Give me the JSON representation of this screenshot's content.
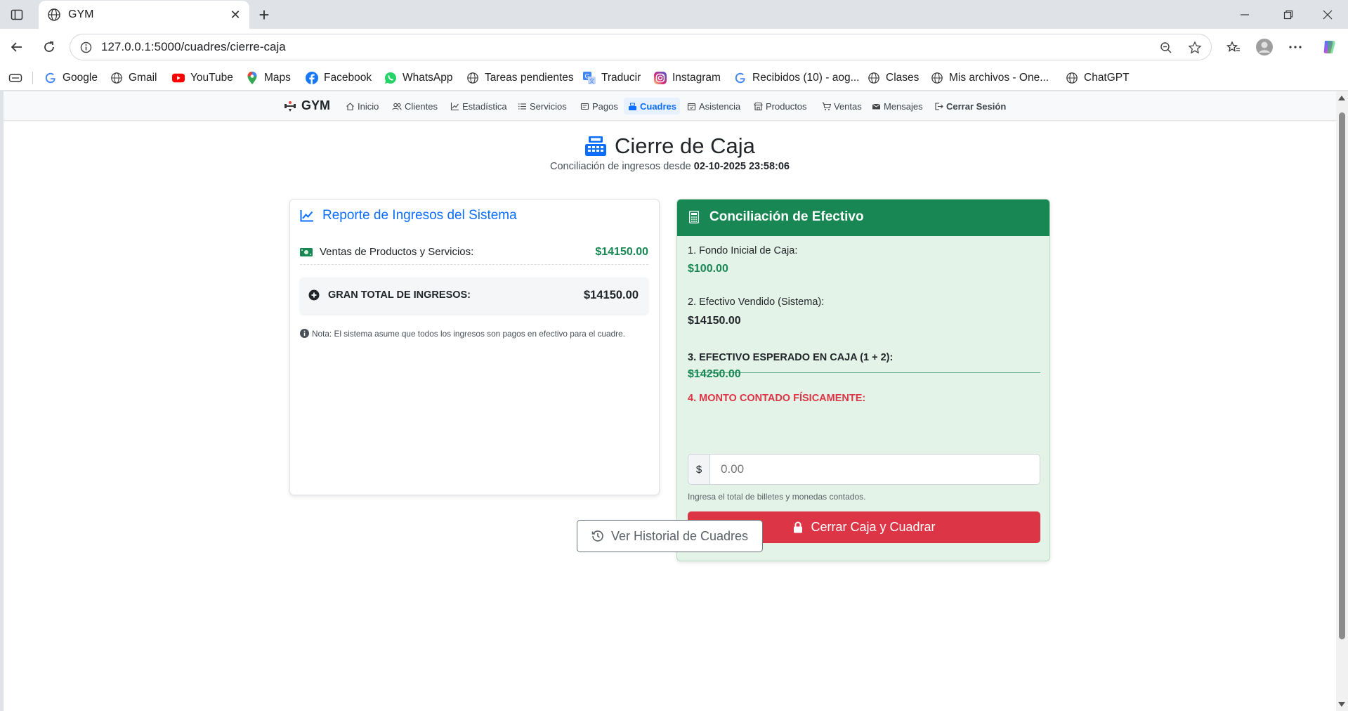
{
  "browser": {
    "tab_title": "GYM",
    "url": "127.0.0.1:5000/cuadres/cierre-caja",
    "bookmarks": [
      {
        "label": "Google",
        "icon": "google-icon"
      },
      {
        "label": "Gmail",
        "icon": "globe-icon"
      },
      {
        "label": "YouTube",
        "icon": "youtube-icon"
      },
      {
        "label": "Maps",
        "icon": "maps-pin-icon"
      },
      {
        "label": "Facebook",
        "icon": "facebook-icon"
      },
      {
        "label": "WhatsApp",
        "icon": "whatsapp-icon"
      },
      {
        "label": "Tareas pendientes",
        "icon": "globe-icon"
      },
      {
        "label": "Traducir",
        "icon": "translate-icon"
      },
      {
        "label": "Instagram",
        "icon": "instagram-icon"
      },
      {
        "label": "Recibidos (10) - aog...",
        "icon": "google-icon"
      },
      {
        "label": "Clases",
        "icon": "globe-icon"
      },
      {
        "label": "Mis archivos - One...",
        "icon": "globe-icon"
      },
      {
        "label": "ChatGPT",
        "icon": "globe-icon"
      }
    ]
  },
  "navbar": {
    "brand": "GYM",
    "links": [
      {
        "label": "Inicio",
        "icon": "house-icon"
      },
      {
        "label": "Clientes",
        "icon": "people-icon"
      },
      {
        "label": "Estadística",
        "icon": "chart-line-icon"
      },
      {
        "label": "Servicios",
        "icon": "list-icon"
      },
      {
        "label": "Pagos",
        "icon": "receipt-icon"
      },
      {
        "label": "Cuadres",
        "icon": "cash-register-icon"
      },
      {
        "label": "Asistencia",
        "icon": "calendar-check-icon"
      },
      {
        "label": "Productos",
        "icon": "shop-icon"
      },
      {
        "label": "Ventas",
        "icon": "cart-icon"
      },
      {
        "label": "Mensajes",
        "icon": "envelope-icon"
      },
      {
        "label": "Cerrar Sesión",
        "icon": "logout-icon"
      }
    ],
    "active": "Cuadres"
  },
  "header": {
    "title": "Cierre de Caja",
    "subtitle_prefix": "Conciliación de ingresos desde",
    "subtitle_date": "02-10-2025 23:58:06"
  },
  "report": {
    "title": "Reporte de Ingresos del Sistema",
    "sales_label": "Ventas de Productos y Servicios:",
    "sales_value": "$14150.00",
    "total_label": "GRAN TOTAL DE INGRESOS:",
    "total_value": "$14150.00",
    "note": "Nota: El sistema asume que todos los ingresos son pagos en efectivo para el cuadre."
  },
  "reconciliation": {
    "title": "Conciliación de Efectivo",
    "fondo_label": "1. Fondo Inicial de Caja:",
    "fondo_value": "$100.00",
    "vendido_label": "2. Efectivo Vendido (Sistema):",
    "vendido_value": "$14150.00",
    "esperado_label": "3. EFECTIVO ESPERADO EN CAJA (1 + 2):",
    "esperado_value": "$14250.00",
    "contado_label": "4. MONTO CONTADO FÍSICAMENTE:",
    "currency_prefix": "$",
    "contado_placeholder": "0.00",
    "help_text": "Ingresa el total de billetes y monedas contados.",
    "submit_label": "Cerrar Caja y Cuadrar"
  },
  "history_button": "Ver Historial de Cuadres",
  "colors": {
    "primary": "#0d6efd",
    "success": "#198754",
    "danger": "#dc3545",
    "card_green_bg": "#e3f3e8"
  }
}
